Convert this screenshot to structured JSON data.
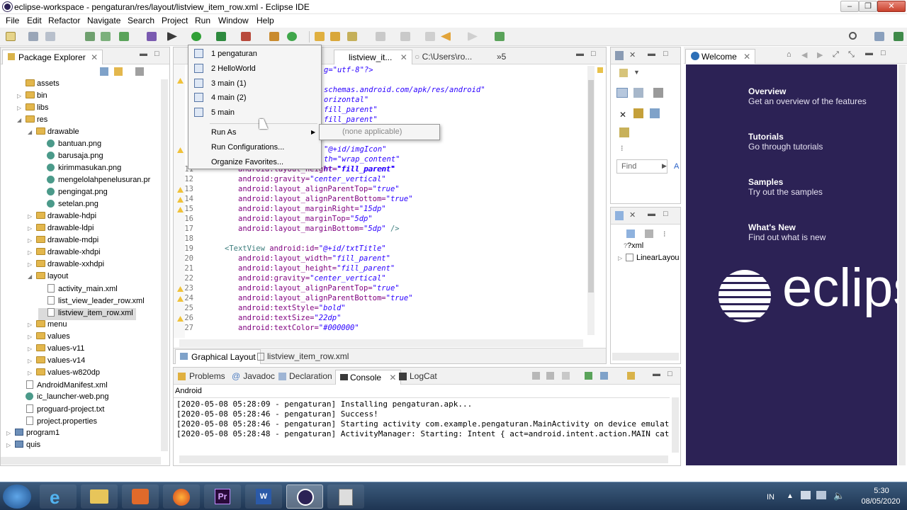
{
  "window": {
    "title": "eclipse-workspace - pengaturan/res/layout/listview_item_row.xml - Eclipse IDE"
  },
  "menubar": [
    "File",
    "Edit",
    "Refactor",
    "Navigate",
    "Search",
    "Project",
    "Run",
    "Window",
    "Help"
  ],
  "package_explorer": {
    "tab": "Package Explorer",
    "items": [
      {
        "label": "assets",
        "type": "folder",
        "indent": 1,
        "twisty": ""
      },
      {
        "label": "bin",
        "type": "folder",
        "indent": 1,
        "twisty": "▷"
      },
      {
        "label": "libs",
        "type": "folder",
        "indent": 1,
        "twisty": "▷"
      },
      {
        "label": "res",
        "type": "folder",
        "indent": 1,
        "twisty": "◢"
      },
      {
        "label": "drawable",
        "type": "folder",
        "indent": 2,
        "twisty": "◢"
      },
      {
        "label": "bantuan.png",
        "type": "png",
        "indent": 3,
        "twisty": ""
      },
      {
        "label": "barusaja.png",
        "type": "png",
        "indent": 3,
        "twisty": ""
      },
      {
        "label": "kirimmasukan.png",
        "type": "png",
        "indent": 3,
        "twisty": ""
      },
      {
        "label": "mengelolahpenelusuran.pr",
        "type": "png",
        "indent": 3,
        "twisty": ""
      },
      {
        "label": "pengingat.png",
        "type": "png",
        "indent": 3,
        "twisty": ""
      },
      {
        "label": "setelan.png",
        "type": "png",
        "indent": 3,
        "twisty": ""
      },
      {
        "label": "drawable-hdpi",
        "type": "folder",
        "indent": 2,
        "twisty": "▷"
      },
      {
        "label": "drawable-ldpi",
        "type": "folder",
        "indent": 2,
        "twisty": "▷"
      },
      {
        "label": "drawable-mdpi",
        "type": "folder",
        "indent": 2,
        "twisty": "▷"
      },
      {
        "label": "drawable-xhdpi",
        "type": "folder",
        "indent": 2,
        "twisty": "▷"
      },
      {
        "label": "drawable-xxhdpi",
        "type": "folder",
        "indent": 2,
        "twisty": "▷"
      },
      {
        "label": "layout",
        "type": "folder",
        "indent": 2,
        "twisty": "◢"
      },
      {
        "label": "activity_main.xml",
        "type": "xml",
        "indent": 3,
        "twisty": ""
      },
      {
        "label": "list_view_leader_row.xml",
        "type": "xml",
        "indent": 3,
        "twisty": ""
      },
      {
        "label": "listview_item_row.xml",
        "type": "xml",
        "indent": 3,
        "twisty": "",
        "selected": true
      },
      {
        "label": "menu",
        "type": "folder",
        "indent": 2,
        "twisty": "▷"
      },
      {
        "label": "values",
        "type": "folder",
        "indent": 2,
        "twisty": "▷"
      },
      {
        "label": "values-v11",
        "type": "folder",
        "indent": 2,
        "twisty": "▷"
      },
      {
        "label": "values-v14",
        "type": "folder",
        "indent": 2,
        "twisty": "▷"
      },
      {
        "label": "values-w820dp",
        "type": "folder",
        "indent": 2,
        "twisty": "▷"
      },
      {
        "label": "AndroidManifest.xml",
        "type": "xml",
        "indent": 1,
        "twisty": ""
      },
      {
        "label": "ic_launcher-web.png",
        "type": "png",
        "indent": 1,
        "twisty": ""
      },
      {
        "label": "proguard-project.txt",
        "type": "xml",
        "indent": 1,
        "twisty": ""
      },
      {
        "label": "project.properties",
        "type": "xml",
        "indent": 1,
        "twisty": ""
      },
      {
        "label": "program1",
        "type": "project",
        "indent": 0,
        "twisty": "▷"
      },
      {
        "label": "quis",
        "type": "project",
        "indent": 0,
        "twisty": "▷"
      }
    ]
  },
  "editor": {
    "tabs": [
      "listview_it...",
      "C:\\Users\\ro...",
      "»5"
    ],
    "bottom_tabs": [
      "Graphical Layout",
      "listview_item_row.xml"
    ],
    "top_fragments": [
      "g=\"utf-8\"?>",
      "schemas.android.com/apk/res/android\"",
      "orizontal\"",
      "fill_parent\"",
      "fill_parent\"",
      "\"@+id/imgIcon\"",
      "th=\"wrap_content\"",
      "ht=\"fill_parent\""
    ]
  },
  "code_lines": [
    {
      "n": "11",
      "attr": "android:layout_height=",
      "val": "\"fill_parent\"",
      "hidden_prefix": true
    },
    {
      "n": "12",
      "attr": "android:gravity=",
      "val": "\"center_vertical\""
    },
    {
      "n": "13",
      "attr": "android:layout_alignParentTop=",
      "val": "\"true\"",
      "warn": true
    },
    {
      "n": "14",
      "attr": "android:layout_alignParentBottom=",
      "val": "\"true\"",
      "warn": true
    },
    {
      "n": "15",
      "attr": "android:layout_marginRight=",
      "val": "\"15dp\"",
      "warn": true
    },
    {
      "n": "16",
      "attr": "android:layout_marginTop=",
      "val": "\"5dp\""
    },
    {
      "n": "17",
      "attr": "android:layout_marginBottom=",
      "val": "\"5dp\"",
      "tail": " />"
    },
    {
      "n": "18",
      "attr": "",
      "val": ""
    },
    {
      "n": "19",
      "tag": "<TextView ",
      "attr": "android:id=",
      "val": "\"@+id/txtTitle\""
    },
    {
      "n": "20",
      "attr": "android:layout_width=",
      "val": "\"fill_parent\""
    },
    {
      "n": "21",
      "attr": "android:layout_height=",
      "val": "\"fill_parent\""
    },
    {
      "n": "22",
      "attr": "android:gravity=",
      "val": "\"center_vertical\""
    },
    {
      "n": "23",
      "attr": "android:layout_alignParentTop=",
      "val": "\"true\"",
      "warn": true
    },
    {
      "n": "24",
      "attr": "android:layout_alignParentBottom=",
      "val": "\"true\"",
      "warn": true
    },
    {
      "n": "25",
      "attr": "android:textStyle=",
      "val": "\"bold\""
    },
    {
      "n": "26",
      "attr": "android:textSize=",
      "val": "\"22dp\"",
      "warn": true
    },
    {
      "n": "27",
      "attr": "android:textColor=",
      "val": "\"#000000\""
    }
  ],
  "run_menu": {
    "items": [
      "1 pengaturan",
      "2 HelloWorld",
      "3 main (1)",
      "4 main (2)",
      "5 main"
    ],
    "run_as": "Run As",
    "run_configurations": "Run Configurations...",
    "organize_favorites": "Organize Favorites...",
    "submenu": "(none applicable)"
  },
  "outline": {
    "find_placeholder": "Find",
    "find_tail": "A",
    "tree": [
      "?xml",
      "LinearLayou"
    ]
  },
  "console": {
    "tabs": [
      "Problems",
      "Javadoc",
      "Declaration",
      "Console",
      "LogCat"
    ],
    "header": "Android",
    "lines": [
      "[2020-05-08 05:28:09 - pengaturan] Installing pengaturan.apk...",
      "[2020-05-08 05:28:46 - pengaturan] Success!",
      "[2020-05-08 05:28:46 - pengaturan] Starting activity com.example.pengaturan.MainActivity on device emulat",
      "[2020-05-08 05:28:48 - pengaturan] ActivityManager: Starting: Intent { act=android.intent.action.MAIN cat"
    ]
  },
  "welcome": {
    "tab": "Welcome",
    "items": [
      {
        "title": "Overview",
        "sub": "Get an overview of the features"
      },
      {
        "title": "Tutorials",
        "sub": "Go through tutorials"
      },
      {
        "title": "Samples",
        "sub": "Try out the samples"
      },
      {
        "title": "What's New",
        "sub": "Find out what is new"
      }
    ],
    "logo_text": "eclips"
  },
  "taskbar": {
    "lang": "IN",
    "time": "5:30",
    "date": "08/05/2020"
  }
}
